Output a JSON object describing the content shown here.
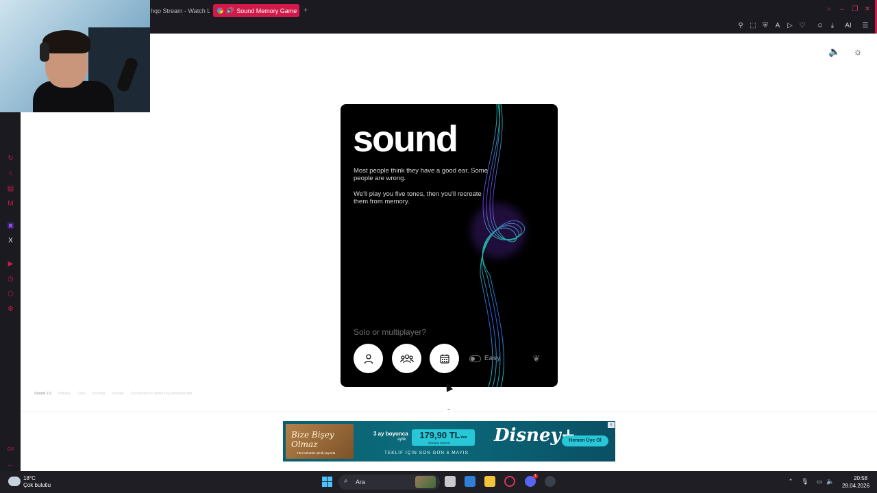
{
  "browser": {
    "tabs": [
      {
        "label": "hqo Stream - Watch Li",
        "active": false
      },
      {
        "label": "Sound Memory Game",
        "active": true,
        "audio_icon": "speaker-icon"
      }
    ],
    "new_tab_icon": "plus-icon",
    "accent_color": "#d11a4a",
    "toolbar_icons": [
      "pin-icon",
      "snapshot-icon",
      "shield-icon",
      "translate-icon",
      "play-icon",
      "heart-icon",
      "user-icon",
      "download-icon",
      "ai-icon",
      "menu-icon"
    ],
    "ai_label": "AI"
  },
  "sidebar": {
    "icons": [
      "history-icon",
      "shopping-icon",
      "messenger-icon",
      "gmail-icon",
      "twitch-icon",
      "x-icon",
      "player-icon",
      "clock-icon",
      "extensions-icon",
      "settings-icon",
      "gx-icon",
      "more-icon"
    ]
  },
  "page": {
    "controls": [
      "volume-icon",
      "sun-icon"
    ],
    "card": {
      "title": "sound",
      "desc1": "Most people think they have a good ear. Some people are wrong.",
      "desc2": "We'll play you five tones, then you'll recreate them from memory.",
      "prompt": "Solo or multiplayer?",
      "modes": [
        "solo-icon",
        "multiplayer-icon",
        "daily-icon"
      ],
      "difficulty_label": "Easy",
      "difficulty_on": false,
      "leaderboard_icon": "laurel-icon"
    },
    "footer": {
      "version": "Sound 1.0",
      "links": [
        "Privacy",
        "Cool",
        "Scoring",
        "Socials",
        "Do not sell or share my personal info"
      ]
    }
  },
  "ad": {
    "poster_title": "Bize Bişey Olmaz",
    "poster_sub": "Tüm bölümler şimdi yayında",
    "promo_line1": "3 ay boyunca",
    "promo_line2": "aylık",
    "price": "179,90 TL",
    "price_unit": "'den",
    "price_sub": "başlayan fiyatlarla",
    "deadline": "TEKLİF İÇİN SON GÜN 6 MAYIS",
    "brand": "Disney+",
    "cta": "Hemen Üye Ol",
    "close": "x"
  },
  "taskbar": {
    "weather_temp": "18°C",
    "weather_desc": "Çok bulutlu",
    "search_label": "Ara",
    "apps": [
      "file-manager-icon",
      "store-icon",
      "folder-icon",
      "opera-gx-icon",
      "discord-icon",
      "steam-icon"
    ],
    "discord_badge": "1",
    "tray": [
      "chevron-up-icon",
      "mic-icon",
      "monitor-icon",
      "speaker-icon"
    ],
    "time": "20:58",
    "date": "28.04.2026"
  }
}
